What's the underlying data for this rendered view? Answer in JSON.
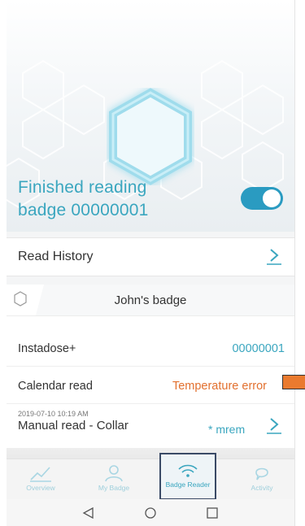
{
  "status": {
    "line1": "Finished reading",
    "line2": "badge 00000001",
    "toggle_on": true
  },
  "read_history": {
    "label": "Read History"
  },
  "badge": {
    "title": "John's badge",
    "device_label": "Instadose+",
    "device_value": "00000001",
    "calendar_label": "Calendar read",
    "calendar_value": "Temperature error",
    "manual_timestamp": "2019-07-10 10:19 AM",
    "manual_title": "Manual read - Collar",
    "manual_unit": "* mrem"
  },
  "nav": {
    "items": [
      {
        "label": "Overview",
        "icon": "chart-icon"
      },
      {
        "label": "My Badge",
        "icon": "user-icon"
      },
      {
        "label": "Badge Reader",
        "icon": "wifi-icon",
        "active": true
      },
      {
        "label": "Activity",
        "icon": "chat-icon"
      }
    ]
  },
  "colors": {
    "accent": "#3aa6bf",
    "toggle": "#2a9bc1",
    "error": "#e2702e",
    "highlight_border": "#3a4a66"
  }
}
